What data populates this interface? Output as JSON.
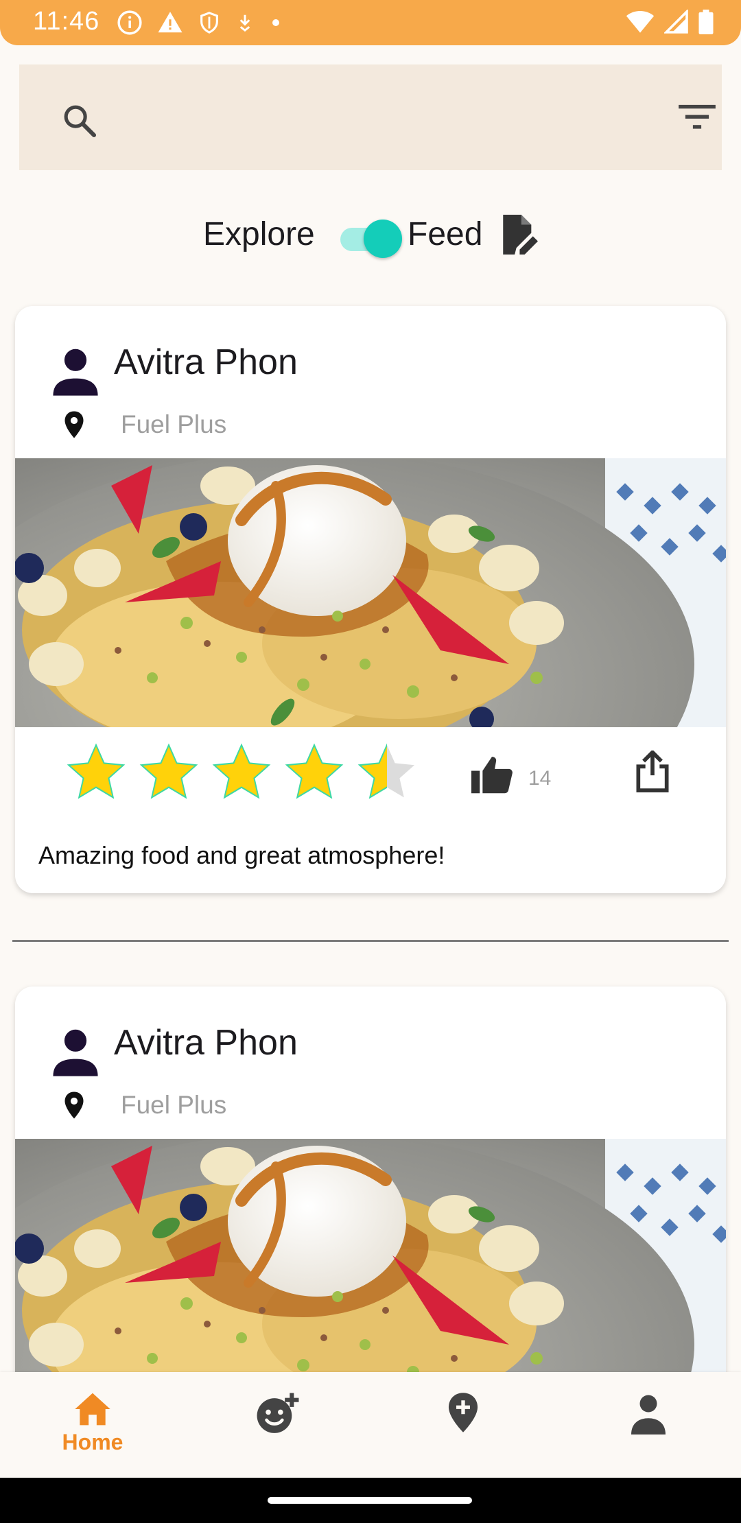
{
  "status_bar": {
    "time": "11:46",
    "left_icons": [
      "info-icon",
      "warning-icon",
      "shield-icon",
      "download-icon",
      "dot-icon"
    ],
    "right_icons": [
      "wifi-icon",
      "signal-icon",
      "battery-icon"
    ]
  },
  "search": {
    "icon": "search-icon",
    "filter_icon": "filter-icon"
  },
  "view_toggle": {
    "left_label": "Explore",
    "right_label": "Feed",
    "state": "Feed",
    "accent_color": "#14CDB9",
    "icon": "edit-document-icon"
  },
  "posts": [
    {
      "user_name": "Avitra Phon",
      "location": "Fuel Plus",
      "image": "pancakes-with-ice-cream-photo",
      "rating": 4.5,
      "rating_max": 5,
      "likes": "14",
      "review": "Amazing food and great atmosphere!"
    },
    {
      "user_name": "Avitra Phon",
      "location": "Fuel Plus",
      "image": "pancakes-with-ice-cream-photo"
    }
  ],
  "bottom_nav": {
    "items": [
      {
        "name": "home",
        "label": "Home",
        "icon": "home-icon",
        "active": true
      },
      {
        "name": "add-friend",
        "label": "",
        "icon": "add-reaction-icon",
        "active": false
      },
      {
        "name": "add-location",
        "label": "",
        "icon": "add-location-icon",
        "active": false
      },
      {
        "name": "profile",
        "label": "",
        "icon": "person-icon",
        "active": false
      }
    ],
    "active_color": "#F08A24",
    "inactive_color": "#444444"
  },
  "colors": {
    "status_bar": "#F7A94A",
    "search_bg": "#F3E9DD",
    "star": "#FFD20A"
  }
}
